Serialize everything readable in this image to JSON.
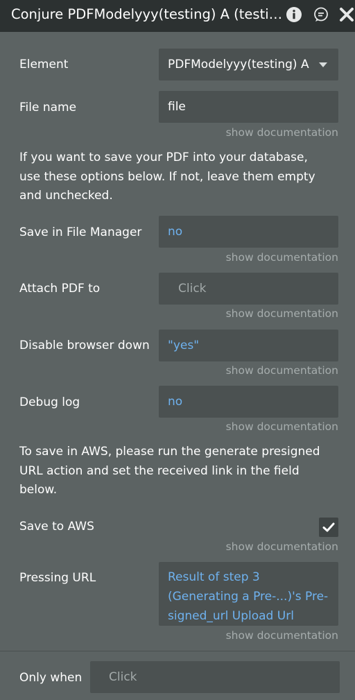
{
  "header": {
    "title": "Conjure PDFModelyyy(testing) A (testing)"
  },
  "rows": {
    "element": {
      "label": "Element",
      "value": "PDFModelyyy(testing) A"
    },
    "file_name": {
      "label": "File name",
      "value": "file"
    },
    "save_in_file_manager": {
      "label": "Save in File Manager",
      "value": "no"
    },
    "attach_pdf_to": {
      "label": "Attach PDF to",
      "placeholder": "Click"
    },
    "disable_browser_down": {
      "label": "Disable browser down",
      "value": "\"yes\""
    },
    "debug_log": {
      "label": "Debug log",
      "value": "no"
    },
    "save_to_aws": {
      "label": "Save to AWS",
      "checked": true
    },
    "pressing_url": {
      "label": "Pressing URL",
      "value": "Result of step 3 (Generating a Pre-...)'s Pre-signed_url Upload Url"
    },
    "only_when": {
      "label": "Only when",
      "placeholder": "Click"
    }
  },
  "doc_link": "show documentation",
  "paragraphs": {
    "database_note": "If you want to save your PDF into your database, use these options below. If not, leave them empty and unchecked.",
    "aws_note": "To save in AWS, please run the generate presigned URL action and set the received link in the field below."
  },
  "colors": {
    "panel_bg": "#5c6363",
    "titlebar_bg": "#2c3131",
    "field_bg": "#4b5151",
    "dynamic_value": "#6fb2ef",
    "doc_link": "#a6adad"
  }
}
